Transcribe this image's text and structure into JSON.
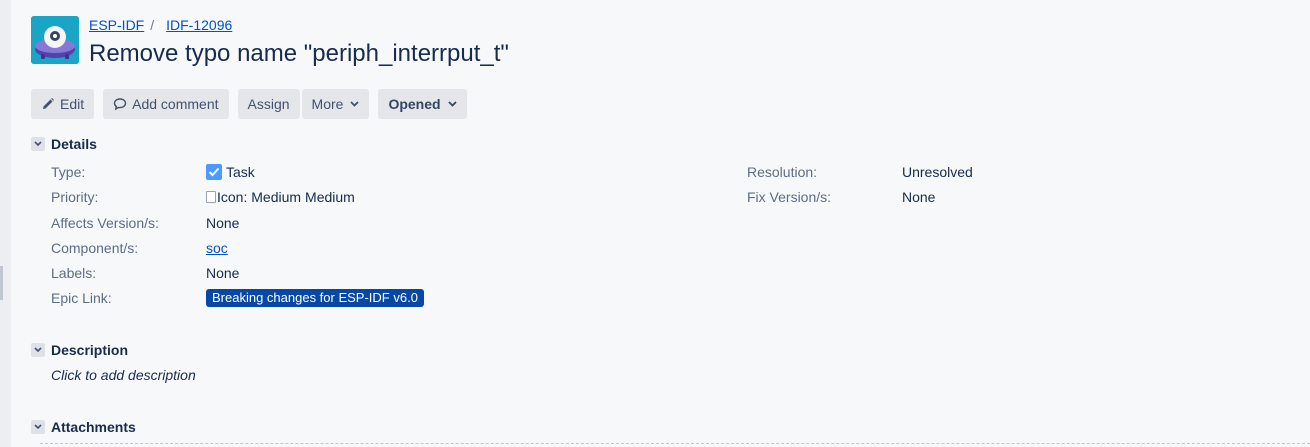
{
  "breadcrumb": {
    "project": "ESP-IDF",
    "separator": "/",
    "issue_key": "IDF-12096"
  },
  "issue": {
    "title": "Remove typo name \"periph_interrput_t\""
  },
  "toolbar": {
    "edit_label": "Edit",
    "comment_label": "Add comment",
    "assign_label": "Assign",
    "more_label": "More",
    "status_label": "Opened"
  },
  "details": {
    "heading": "Details",
    "left": [
      {
        "label": "Type:",
        "value": "Task",
        "icon": "task-check-icon"
      },
      {
        "label": "Priority:",
        "value": "Medium",
        "icon_alt": "Icon: Medium"
      },
      {
        "label": "Affects Version/s:",
        "value": "None"
      },
      {
        "label": "Component/s:",
        "value": "soc"
      },
      {
        "label": "Labels:",
        "value": "None"
      },
      {
        "label": "Epic Link:",
        "value": "Breaking changes for ESP-IDF v6.0"
      }
    ],
    "right": [
      {
        "label": "Resolution:",
        "value": "Unresolved"
      },
      {
        "label": "Fix Version/s:",
        "value": "None"
      }
    ]
  },
  "description": {
    "heading": "Description",
    "placeholder": "Click to add description"
  },
  "attachments": {
    "heading": "Attachments"
  },
  "colors": {
    "link": "#0052cc",
    "epic_bg": "#0747a6",
    "avatar_bg": "#1aa5c7",
    "button_bg": "#e4e6ea",
    "task_icon": "#4c9aff"
  }
}
